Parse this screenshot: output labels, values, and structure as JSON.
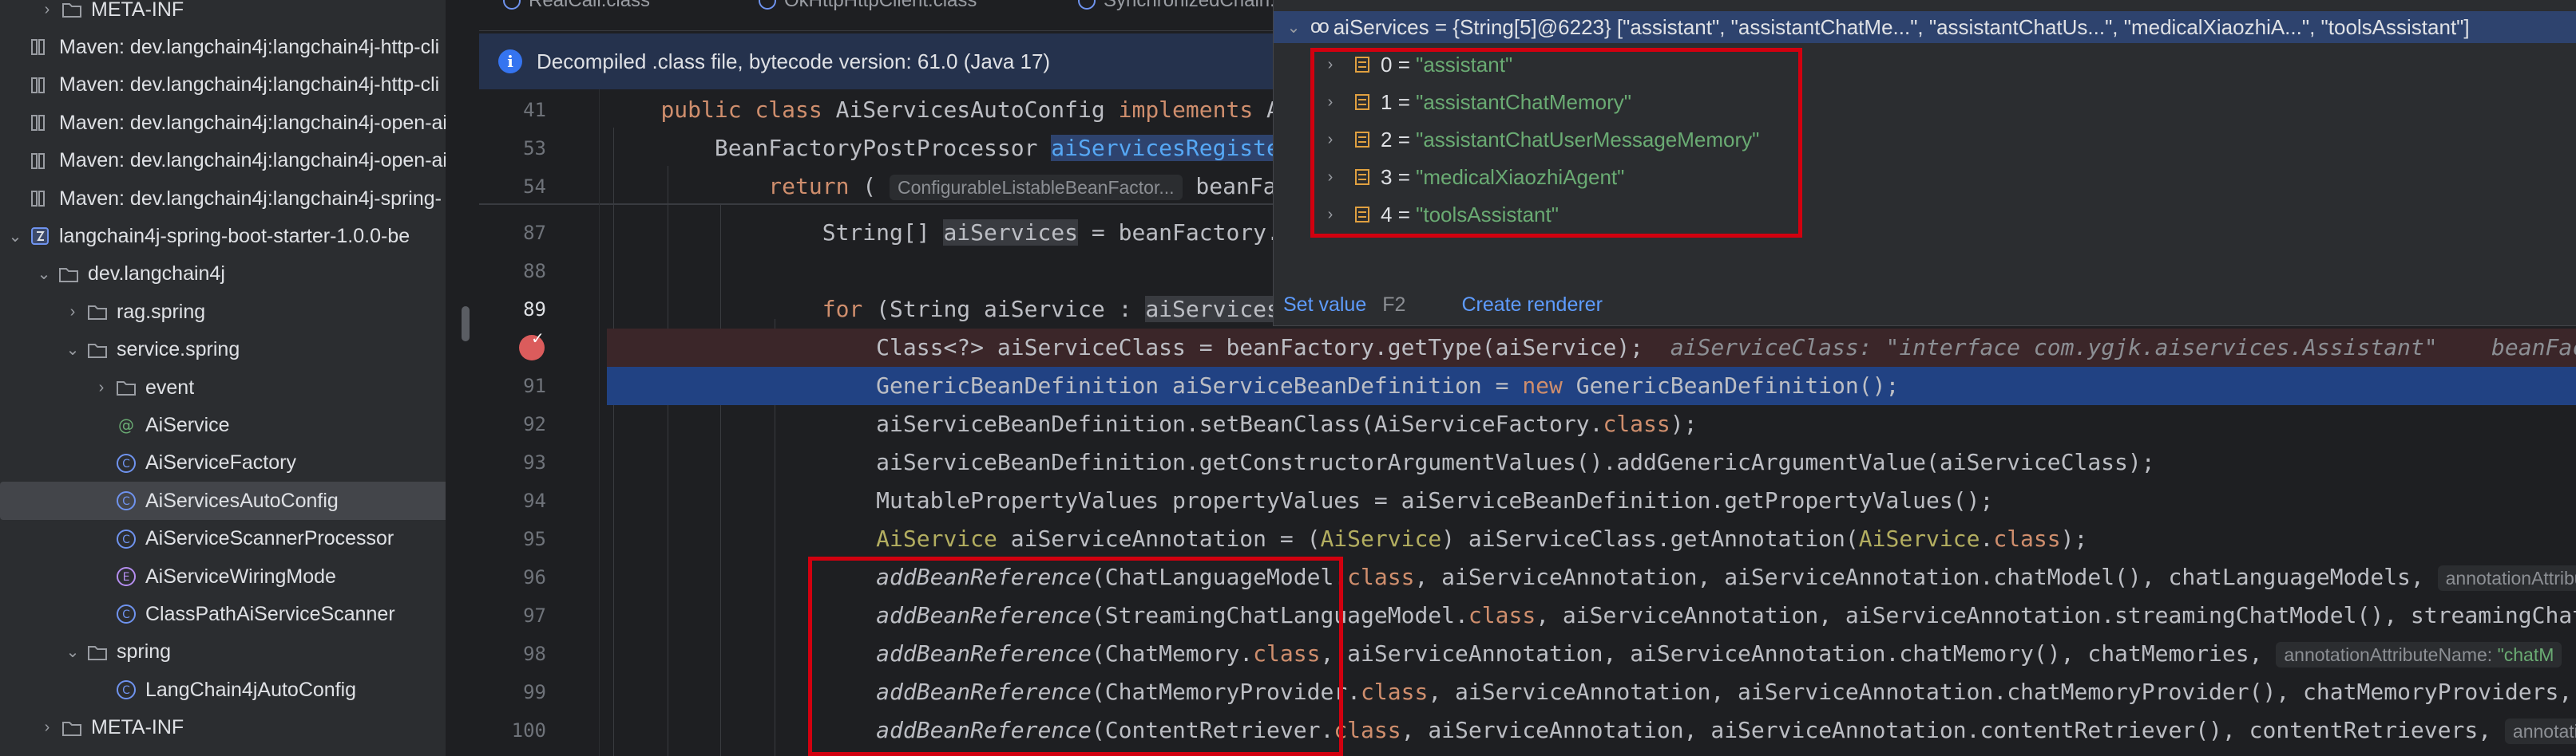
{
  "project_tree": {
    "rows": [
      {
        "chev": "›",
        "icon": "folder-icon",
        "label": "META-INF"
      },
      {
        "chev": "",
        "icon": "library-icon",
        "label": "Maven: dev.langchain4j:langchain4j-http-cli"
      },
      {
        "chev": "",
        "icon": "library-icon",
        "label": "Maven: dev.langchain4j:langchain4j-http-cli"
      },
      {
        "chev": "",
        "icon": "library-icon",
        "label": "Maven: dev.langchain4j:langchain4j-open-ai"
      },
      {
        "chev": "",
        "icon": "library-icon",
        "label": "Maven: dev.langchain4j:langchain4j-open-ai"
      },
      {
        "chev": "",
        "icon": "library-icon",
        "label": "Maven: dev.langchain4j:langchain4j-spring-"
      },
      {
        "chev": "⌄",
        "icon": "jar-icon",
        "label": "langchain4j-spring-boot-starter-1.0.0-be"
      },
      {
        "chev": "⌄",
        "icon": "folder-icon",
        "label": "dev.langchain4j"
      },
      {
        "chev": "›",
        "icon": "folder-icon",
        "label": "rag.spring"
      },
      {
        "chev": "⌄",
        "icon": "folder-icon",
        "label": "service.spring"
      },
      {
        "chev": "›",
        "icon": "folder-icon",
        "label": "event"
      },
      {
        "chev": "",
        "icon": "annotation-icon",
        "label": "AiService"
      },
      {
        "chev": "",
        "icon": "class-icon",
        "label": "AiServiceFactory"
      },
      {
        "chev": "",
        "icon": "class-icon",
        "label": "AiServicesAutoConfig",
        "selected": true
      },
      {
        "chev": "",
        "icon": "class-icon",
        "label": "AiServiceScannerProcessor"
      },
      {
        "chev": "",
        "icon": "enum-icon",
        "label": "AiServiceWiringMode"
      },
      {
        "chev": "",
        "icon": "class-icon",
        "label": "ClassPathAiServiceScanner"
      },
      {
        "chev": "⌄",
        "icon": "folder-icon",
        "label": "spring"
      },
      {
        "chev": "",
        "icon": "class-icon",
        "label": "LangChain4jAutoConfig"
      },
      {
        "chev": "›",
        "icon": "folder-icon",
        "label": "META-INF"
      }
    ]
  },
  "tabs": [
    "RealCall.class",
    "OkHttpHttpClient.class",
    "SynchronizedChain..."
  ],
  "banner": {
    "text": "Decompiled .class file, bytecode version: 61.0 (Java 17)"
  },
  "gutter": {
    "line_numbers": [
      "41",
      "53",
      "54",
      "87",
      "88",
      "89",
      "90",
      "91",
      "92",
      "93",
      "94",
      "95",
      "96",
      "97",
      "98",
      "99",
      "100"
    ]
  },
  "code": {
    "l41": {
      "kw1": "public class",
      "name": " AiServicesAutoConfig ",
      "kw2": "implements",
      "rest": " Appl"
    },
    "l53": {
      "type": "BeanFactoryPostProcessor ",
      "method": "aiServicesRegisterin"
    },
    "l54": {
      "kw": "return",
      "paren": " ( ",
      "hint": "ConfigurableListableBeanFactor...",
      "rest": " beanFa"
    },
    "l87": {
      "pre": "String[] ",
      "var": "aiServices",
      "post": " = beanFactory.get"
    },
    "l89": {
      "kw": "for",
      "pre": " (String aiService : ",
      "var": "aiServices",
      "post": ") {"
    },
    "l90": {
      "code": "Class<?> aiServiceClass = beanFactory.getType(aiService);",
      "inline": "aiServiceClass: \"interface com.ygjk.aiservices.Assistant\"    beanFactory"
    },
    "l91": {
      "pre": "GenericBeanDefinition aiServiceBeanDefinition = ",
      "kw": "new",
      "post": " GenericBeanDefinition();"
    },
    "l92": {
      "pre": "aiServiceBeanDefinition.setBeanClass(AiServiceFactory.",
      "kw": "class",
      "post": ");"
    },
    "l93": {
      "code": "aiServiceBeanDefinition.getConstructorArgumentValues().addGenericArgumentValue(aiServiceClass);"
    },
    "l94": {
      "code": "MutablePropertyValues propertyValues = aiServiceBeanDefinition.getPropertyValues();"
    },
    "l95": {
      "an1": "AiService",
      "pre": " aiServiceAnnotation = (",
      "an2": "AiService",
      "mid": ") aiServiceClass.getAnnotation(",
      "an3": "AiService",
      "dot": ".",
      "kw": "class",
      "post": ");"
    },
    "l96": {
      "method": "addBeanReference",
      "pre": "(ChatLanguageModel.",
      "kw": "class",
      "post": ", aiServiceAnnotation, aiServiceAnnotation.chatModel(), chatLanguageModels, ",
      "hint": "annotationAttributeN"
    },
    "l97": {
      "method": "addBeanReference",
      "pre": "(StreamingChatLanguageModel.",
      "kw": "class",
      "post": ", aiServiceAnnotation, aiServiceAnnotation.streamingChatModel(), streamingChatLang"
    },
    "l98": {
      "method": "addBeanReference",
      "pre": "(ChatMemory.",
      "kw": "class",
      "post": ", aiServiceAnnotation, aiServiceAnnotation.chatMemory(), chatMemories, ",
      "hint": "annotationAttributeName:",
      "hint_str": " \"chatM"
    },
    "l99": {
      "method": "addBeanReference",
      "pre": "(ChatMemoryProvider.",
      "kw": "class",
      "post": ", aiServiceAnnotation, aiServiceAnnotation.chatMemoryProvider(), chatMemoryProviders, ",
      "hint": "ann"
    },
    "l100": {
      "method": "addBeanReference",
      "pre": "(ContentRetriever.",
      "kw": "class",
      "post": ", aiServiceAnnotation, aiServiceAnnotation.contentRetriever(), contentRetrievers, ",
      "hint": "annotationAttri"
    }
  },
  "debugger_popup": {
    "header": "aiServices = {String[5]@6223} [\"assistant\", \"assistantChatMe...\", \"assistantChatUs...\", \"medicalXiaozhiA...\", \"toolsAssistant\"]",
    "items": [
      {
        "index": "0",
        "value": "\"assistant\""
      },
      {
        "index": "1",
        "value": "\"assistantChatMemory\""
      },
      {
        "index": "2",
        "value": "\"assistantChatUserMessageMemory\""
      },
      {
        "index": "3",
        "value": "\"medicalXiaozhiAgent\""
      },
      {
        "index": "4",
        "value": "\"toolsAssistant\""
      }
    ],
    "set_value": "Set value",
    "set_value_key": "F2",
    "create_renderer": "Create renderer"
  },
  "colors": {
    "annotation_red_box": "#d2000f",
    "exec_line": "#214283",
    "breakpoint": "#db5c5c"
  }
}
